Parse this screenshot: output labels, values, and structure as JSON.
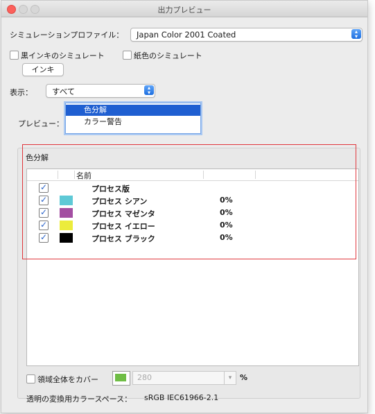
{
  "window": {
    "title": "出力プレビュー"
  },
  "simulation": {
    "profile_label": "シミュレーションプロファイル：",
    "profile_value": "Japan Color 2001 Coated",
    "simulate_black_label": "黒インキのシミュレート",
    "simulate_paper_label": "紙色のシミュレート",
    "ink_button": "インキ"
  },
  "display": {
    "label": "表示：",
    "value": "すべて"
  },
  "preview": {
    "label": "プレビュー：",
    "options": [
      "色分解",
      "カラー警告"
    ],
    "selected": 0
  },
  "separations": {
    "group_label": "色分解",
    "column_name": "名前",
    "rows": [
      {
        "name": "プロセス版",
        "value": "",
        "swatch": ""
      },
      {
        "name": "プロセス シアン",
        "value": "0%",
        "swatch": "#5ec9d6"
      },
      {
        "name": "プロセス マゼンタ",
        "value": "0%",
        "swatch": "#a34ea2"
      },
      {
        "name": "プロセス イエロー",
        "value": "0%",
        "swatch": "#ecec3c"
      },
      {
        "name": "プロセス ブラック",
        "value": "0%",
        "swatch": "#000000"
      }
    ]
  },
  "coverage": {
    "label": "領域全体をカバー",
    "swatch_color": "#6fbd45",
    "value": "280",
    "unit": "%"
  },
  "footer": {
    "transparency_label": "透明の変換用カラースペース：",
    "transparency_value": "sRGB IEC61966-2.1"
  },
  "colors": {
    "highlight_box": "#e0343a",
    "selection": "#1f5fd1"
  }
}
